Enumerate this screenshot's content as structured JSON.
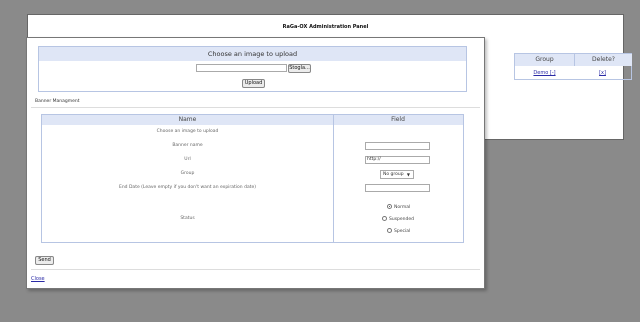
{
  "background_panel": {
    "title": "RaGa-OX Administration Panel",
    "table": {
      "col_group": "Group",
      "col_delete": "Delete?",
      "row_group": "Demo [-]",
      "row_delete": "[x]"
    }
  },
  "upload": {
    "heading": "Choose an image to upload",
    "browse_label": "Stogla...",
    "upload_label": "Upload"
  },
  "banner_section_title": "Banner Managment",
  "form": {
    "col_name": "Name",
    "col_field": "Field",
    "rows": {
      "choose_image": "Choose an image to upload",
      "banner_name": "Banner name",
      "url": "Url",
      "group": "Group",
      "end_date": "End Date (Leave empty if you don't want an expiration date)",
      "status": "Status"
    },
    "url_value": "http://",
    "group_value": "No group",
    "status_options": [
      "Normal",
      "Suspended",
      "Special"
    ],
    "status_selected": "Normal"
  },
  "send_label": "Send",
  "close_label": "Close",
  "colors": {
    "header_fill": "#dfe6f6",
    "border": "#b7c5e3",
    "overlay": "#8a8a8a",
    "link": "#2a2aa6"
  }
}
